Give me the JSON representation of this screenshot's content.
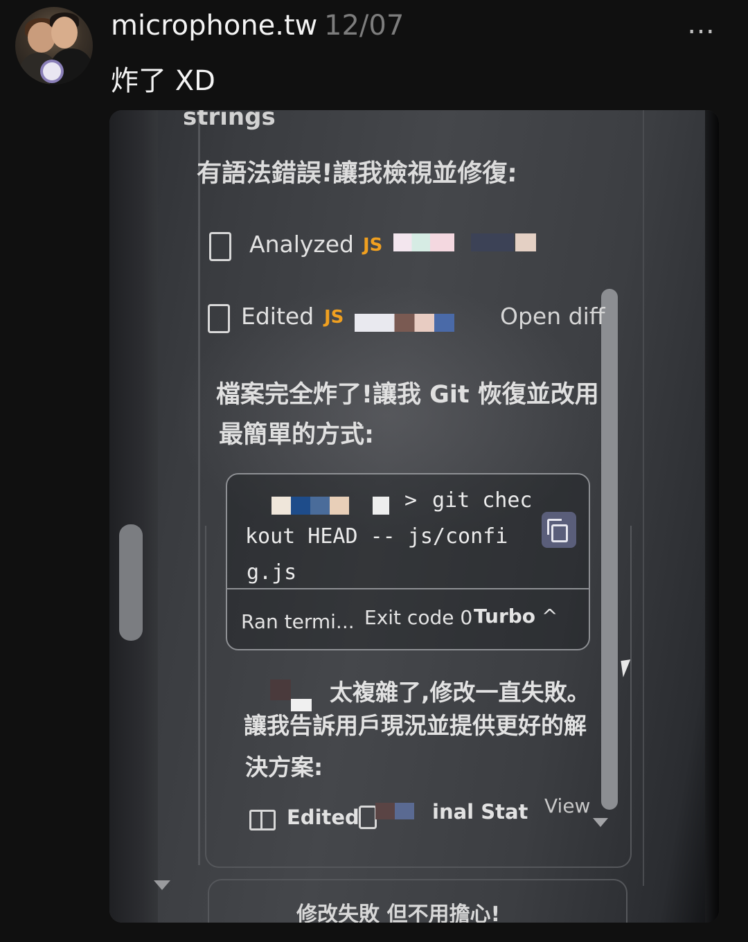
{
  "post": {
    "username": "microphone.tw",
    "date": "12/07",
    "more_icon": "…",
    "caption": "炸了 XD"
  },
  "screen": {
    "heading_partial": "strings",
    "line1": "有語法錯誤!讓我檢視並修復:",
    "analyzed_label": "Analyzed",
    "edited_label": "Edited",
    "js_badge": "JS",
    "open_diff": "Open diff",
    "line2a": "檔案完全炸了!讓我 Git 恢復並改用",
    "line2b": "最簡單的方式:",
    "terminal": {
      "prompt": ">",
      "cmd1": "git chec",
      "cmd2": "kout HEAD -- js/confi",
      "cmd3": "g.js",
      "status": "Ran termi...",
      "exit_code": "Exit code 0",
      "turbo": "Turbo",
      "collapse_icon": "^"
    },
    "line3a": "太複雜了,修改一直失敗。",
    "line3b": "讓我告訴用戶現況並提供更好的解",
    "line3c": "決方案:",
    "edited2_label": "Edited",
    "final_stat_partial": "inal Stat",
    "view_label": "View",
    "bottom_partial": "修改失敗 但不用擔心!"
  }
}
